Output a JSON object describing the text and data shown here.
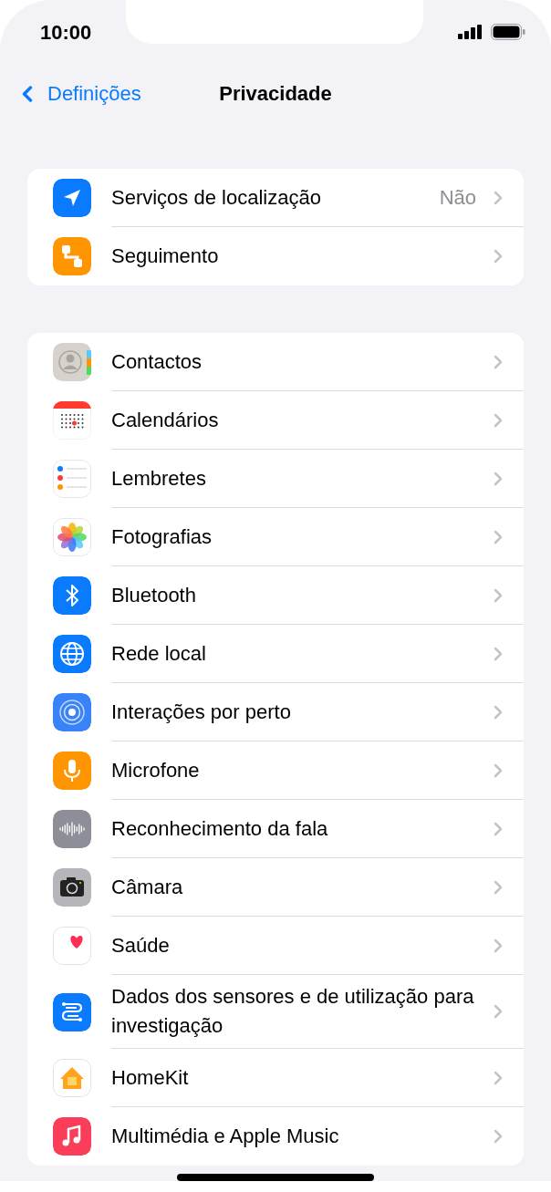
{
  "status_bar": {
    "time": "10:00"
  },
  "nav": {
    "back": "Definições",
    "title": "Privacidade"
  },
  "groups": [
    {
      "rows": [
        {
          "kind": "location",
          "label": "Serviços de localização",
          "value": "Não"
        },
        {
          "kind": "tracking",
          "label": "Seguimento"
        }
      ]
    },
    {
      "rows": [
        {
          "kind": "contacts",
          "label": "Contactos"
        },
        {
          "kind": "calendar",
          "label": "Calendários"
        },
        {
          "kind": "reminders",
          "label": "Lembretes"
        },
        {
          "kind": "photos",
          "label": "Fotografias"
        },
        {
          "kind": "bluetooth",
          "label": "Bluetooth"
        },
        {
          "kind": "network",
          "label": "Rede local"
        },
        {
          "kind": "nearby",
          "label": "Interações por perto"
        },
        {
          "kind": "microphone",
          "label": "Microfone"
        },
        {
          "kind": "speech",
          "label": "Reconhecimento da fala"
        },
        {
          "kind": "camera",
          "label": "Câmara"
        },
        {
          "kind": "health",
          "label": "Saúde"
        },
        {
          "kind": "research",
          "label": "Dados dos sensores e de utilização para investigação"
        },
        {
          "kind": "home",
          "label": "HomeKit"
        },
        {
          "kind": "music",
          "label": "Multimédia e Apple Music"
        }
      ]
    }
  ]
}
